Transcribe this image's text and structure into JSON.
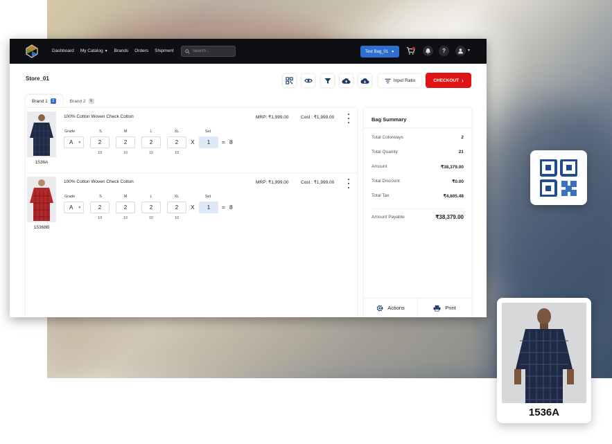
{
  "nav": {
    "items": [
      {
        "label": "Dashboard"
      },
      {
        "label": "My Catalog"
      },
      {
        "label": "Brands"
      },
      {
        "label": "Orders"
      },
      {
        "label": "Shipment"
      }
    ],
    "search_placeholder": "Search...",
    "bag_selector": "Test Bag_01"
  },
  "page": {
    "title": "Store_01",
    "input_ratio_label": "Input Ratio",
    "checkout_label": "CHECKOUT"
  },
  "tabs": [
    {
      "label": "Brand 1",
      "badge": "2",
      "active": true
    },
    {
      "label": "Brand 2",
      "badge": "N",
      "active": false
    }
  ],
  "size_headers": {
    "grade": "Grade",
    "s": "S",
    "m": "M",
    "l": "L",
    "xl": "XL",
    "set": "Set"
  },
  "items": [
    {
      "name": "100% Cotton Woven Check Cotton",
      "sku": "1536A",
      "mrp": "MRP: ₹1,999.00",
      "cost": "Cost : ₹1,999.00",
      "grade": "A",
      "qty": {
        "s": "2",
        "m": "2",
        "l": "2",
        "xl": "2"
      },
      "avail": {
        "s": "10",
        "m": "10",
        "l": "10",
        "xl": "10"
      },
      "set": "1",
      "times": "X",
      "equals": "=",
      "total": "8",
      "shirt_color": "#1f2a44"
    },
    {
      "name": "100% Cotton Woven Check Cotton",
      "sku": "15368B",
      "mrp": "MRP: ₹1,999.00",
      "cost": "Cost : ₹1,999.00",
      "grade": "A",
      "qty": {
        "s": "2",
        "m": "2",
        "l": "2",
        "xl": "2"
      },
      "avail": {
        "s": "10",
        "m": "10",
        "l": "10",
        "xl": "10"
      },
      "set": "1",
      "times": "X",
      "equals": "=",
      "total": "8",
      "shirt_color": "#b3282a"
    }
  ],
  "summary": {
    "title": "Bag Summary",
    "rows": [
      {
        "label": "Total Colorways",
        "value": "2"
      },
      {
        "label": "Total Quanity",
        "value": "21"
      },
      {
        "label": "Amount",
        "value": "₹38,379.00"
      },
      {
        "label": "Total Discount",
        "value": "₹0.00"
      },
      {
        "label": "Total Tax",
        "value": "₹4,605.48"
      }
    ],
    "payable_label": "Amount Payable",
    "payable_value": "₹38,379.00",
    "actions_label": "Actions",
    "print_label": "Print"
  },
  "product_card": {
    "label": "1536A"
  },
  "colors": {
    "accent_blue": "#2f6fd1",
    "checkout_red": "#e01414",
    "icon_navy": "#1f3a6d",
    "topbar": "#0e0f12"
  }
}
